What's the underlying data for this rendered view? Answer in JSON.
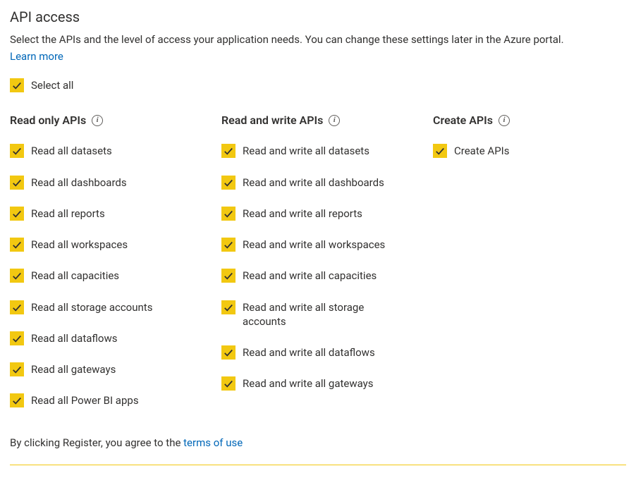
{
  "header": {
    "title": "API access",
    "description": "Select the APIs and the level of access your application needs. You can change these settings later in the Azure portal.",
    "learn_more": "Learn more",
    "select_all": "Select all"
  },
  "columns": {
    "readonly": {
      "title": "Read only APIs",
      "items": [
        "Read all datasets",
        "Read all dashboards",
        "Read all reports",
        "Read all workspaces",
        "Read all capacities",
        "Read all storage accounts",
        "Read all dataflows",
        "Read all gateways",
        "Read all Power BI apps"
      ]
    },
    "readwrite": {
      "title": "Read and write APIs",
      "items": [
        "Read and write all datasets",
        "Read and write all dashboards",
        "Read and write all reports",
        "Read and write all workspaces",
        "Read and write all capacities",
        "Read and write all storage accounts",
        "Read and write all dataflows",
        "Read and write all gateways"
      ]
    },
    "create": {
      "title": "Create APIs",
      "items": [
        "Create APIs"
      ]
    }
  },
  "footer": {
    "prefix": "By clicking Register, you agree to the ",
    "terms": "terms of use"
  }
}
